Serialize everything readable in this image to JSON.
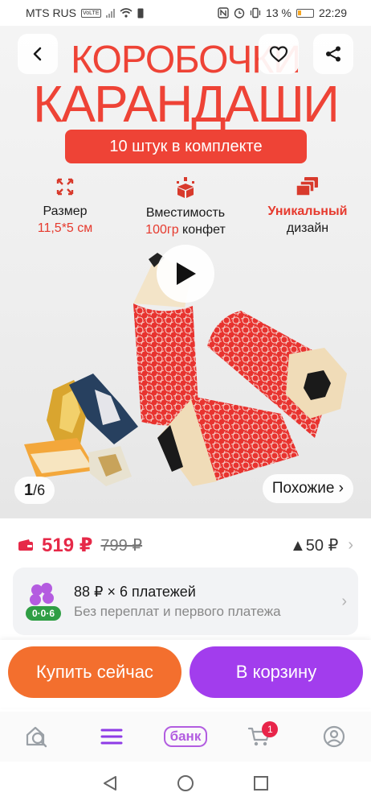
{
  "status": {
    "carrier": "MTS RUS",
    "volte": "VoLTE",
    "battery_pct": "13 %",
    "time": "22:29"
  },
  "hero": {
    "title_line1": "КОРОБОЧКИ",
    "title_line2": "КАРАНДАШИ",
    "kit_badge": "10 штук в комплекте",
    "features": [
      {
        "icon": "expand-arrows-icon",
        "line1": "Размер",
        "line2": "11,5*5 см"
      },
      {
        "icon": "box-icon",
        "line1": "Вместимость",
        "line2_accent": "100гр",
        "line2_rest": " конфет"
      },
      {
        "icon": "layers-icon",
        "line1": "Уникальный",
        "line2": "дизайн"
      }
    ],
    "counter_current": "1",
    "counter_sep": "/ ",
    "counter_total": "6",
    "similar_label": "Похожие ›"
  },
  "price": {
    "current": "519 ₽",
    "old": "799 ₽",
    "bonus": "▲50 ₽"
  },
  "installment": {
    "badge": "0·0·6",
    "title": "88 ₽ × 6 платежей",
    "subtitle": "Без переплат и первого платежа"
  },
  "actions": {
    "buy_now": "Купить сейчас",
    "add_to_cart": "В корзину"
  },
  "tabbar": {
    "bank_label": "банк",
    "cart_count": "1"
  },
  "colors": {
    "brand_red": "#ee4336",
    "price_red": "#e62948",
    "buy_orange": "#f36f2e",
    "cart_purple": "#a23ded"
  }
}
